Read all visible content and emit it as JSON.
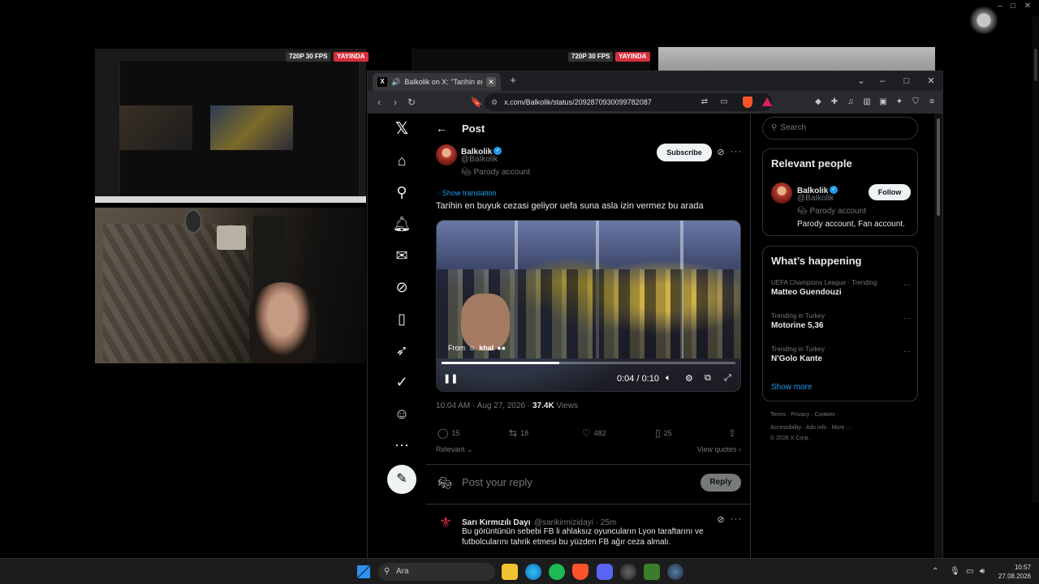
{
  "stream_overlay": {
    "resolution_badge": "720P 30 FPS",
    "live_badge": "YAYINDA"
  },
  "browser": {
    "tab_title": "Balkolik on X: \"Tarihin en buyük",
    "url": "x.com/Balkolik/status/2092870930099782087"
  },
  "post": {
    "header_title": "Post",
    "author": {
      "name": "Balkolik",
      "handle": "@BaIkolik",
      "label": "Parody account"
    },
    "subscribe_label": "Subscribe",
    "show_translation": "Show translation",
    "text": "Tarihin en buyuk cezasi geliyor uefa suna asla izin vermez bu arada",
    "video": {
      "watermark_from": "From",
      "watermark_name": "khal",
      "time": "0:04 / 0:10",
      "progress": 0.4
    },
    "timestamp": "10:04 AM · Aug 27, 2026 · ",
    "views_count": "37.4K",
    "views_label": " Views",
    "actions": {
      "replies": "15",
      "reposts": "18",
      "likes": "482",
      "bookmarks": "25"
    },
    "sort_label": "Relevant",
    "view_quotes": "View quotes",
    "reply_placeholder": "Post your reply",
    "reply_button": "Reply"
  },
  "comment": {
    "name": "Sarı Kırmızılı Dayı",
    "handle": "@sarikirmizidayi · 25m",
    "text": "Bu görüntünün sebebi FB li ahlaksız oyuncuların Lyon taraftarını ve futbolcularını tahrik etmesi bu yüzden FB ağır ceza almalı."
  },
  "sidebar": {
    "search_placeholder": "Search",
    "relevant_people": {
      "title": "Relevant people",
      "name": "Balkolik",
      "handle": "@BaIkolik",
      "label": "Parody account",
      "bio": "Parody account, Fan account.",
      "follow_label": "Follow"
    },
    "whats_happening": {
      "title": "What’s happening",
      "trends": [
        {
          "category": "UEFA Champions League · Trending",
          "name": "Matteo Guendouzi"
        },
        {
          "category": "Trending in Turkey",
          "name": "Motorine 5,36"
        },
        {
          "category": "Trending in Turkey",
          "name": "N'Golo Kante"
        }
      ],
      "show_more": "Show more"
    },
    "footer": {
      "line1": "Terms  ·  Privacy  ·  Cookies  ·",
      "line2": "Accessibility  ·  Ads info  ·  More ···",
      "line3": "© 2026 X Corp."
    }
  },
  "taskbar": {
    "search_placeholder": "Ara",
    "time": "10:57",
    "date": "27.08.2026"
  },
  "colors": {
    "accent_blue": "#1d9bf0",
    "live_red": "#d62e3a",
    "background": "#000000"
  }
}
